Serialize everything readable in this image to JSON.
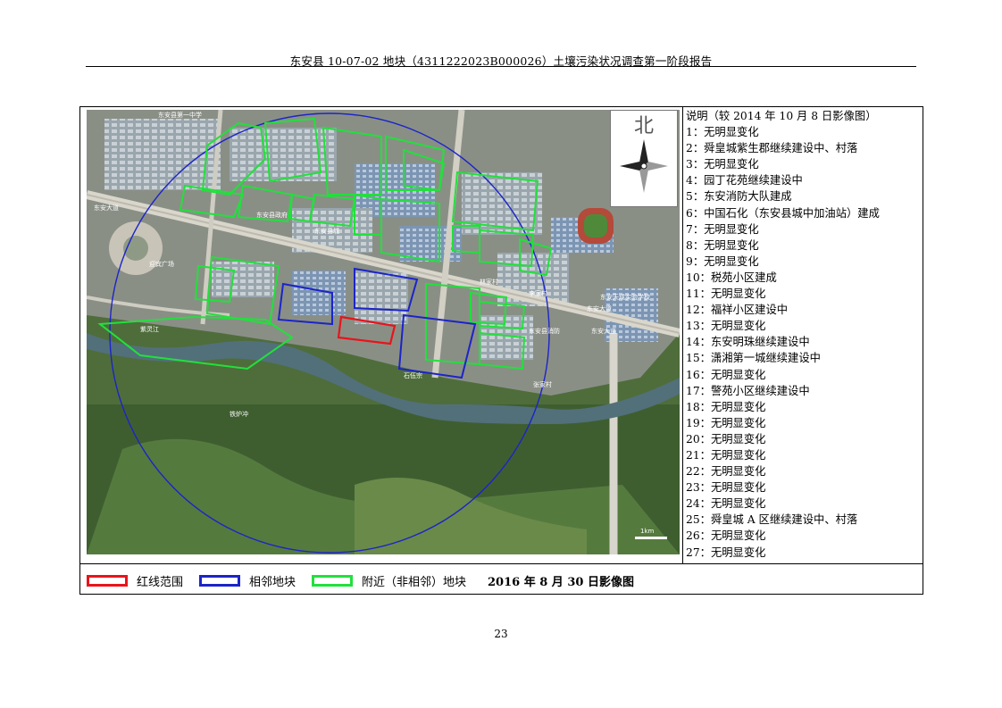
{
  "header": {
    "title": "东安县 10-07-02 地块（4311222023B000026）土壤污染状况调查第一阶段报告"
  },
  "map": {
    "compass_label": "北",
    "scale_label": "1km",
    "place_labels": [
      "东安县第一中学",
      "东安大道",
      "东安县城",
      "东安大道",
      "迎宾广场",
      "石伍宗",
      "东安天成实验学校",
      "李家村",
      "东安县政府",
      "东安县消防",
      "紫灵江",
      "林家村",
      "张家村",
      "铁炉冲",
      "东安大道"
    ],
    "colors": {
      "red_line": "#e8141b",
      "adjacent_blue": "#1c24c8",
      "nearby_green": "#22e03c"
    }
  },
  "legend_panel": {
    "title": "说明（较 2014 年 10 月 8 日影像图）",
    "items": [
      {
        "num": "1：",
        "text": "无明显变化"
      },
      {
        "num": "2：",
        "text": "舜皇城紫生郡继续建设中、村落"
      },
      {
        "num": "3：",
        "text": "无明显变化"
      },
      {
        "num": "4：",
        "text": "园丁花苑继续建设中"
      },
      {
        "num": "5：",
        "text": "东安消防大队建成"
      },
      {
        "num": "6：",
        "text": "中国石化（东安县城中加油站）建成"
      },
      {
        "num": "7：",
        "text": "无明显变化"
      },
      {
        "num": "8：",
        "text": "无明显变化"
      },
      {
        "num": "9：",
        "text": "无明显变化"
      },
      {
        "num": "10：",
        "text": "税苑小区建成"
      },
      {
        "num": "11：",
        "text": "无明显变化"
      },
      {
        "num": "12：",
        "text": "福祥小区建设中"
      },
      {
        "num": "13：",
        "text": "无明显变化"
      },
      {
        "num": "14：",
        "text": "东安明珠继续建设中"
      },
      {
        "num": "15：",
        "text": "潇湘第一城继续建设中"
      },
      {
        "num": "16：",
        "text": "无明显变化"
      },
      {
        "num": "17：",
        "text": "警苑小区继续建设中"
      },
      {
        "num": "18：",
        "text": "无明显变化"
      },
      {
        "num": "19：",
        "text": "无明显变化"
      },
      {
        "num": "20：",
        "text": "无明显变化"
      },
      {
        "num": "21：",
        "text": "无明显变化"
      },
      {
        "num": "22：",
        "text": "无明显变化"
      },
      {
        "num": "23：",
        "text": "无明显变化"
      },
      {
        "num": "24：",
        "text": "无明显变化"
      },
      {
        "num": "25：",
        "text": "舜皇城 A 区继续建设中、村落"
      },
      {
        "num": "26：",
        "text": "无明显变化"
      },
      {
        "num": "27：",
        "text": "无明显变化"
      }
    ]
  },
  "key": {
    "red_label": "红线范围",
    "blue_label": "相邻地块",
    "green_label": "附近（非相邻）地块"
  },
  "caption": "2016 年 8 月 30 日影像图",
  "page_number": "23"
}
